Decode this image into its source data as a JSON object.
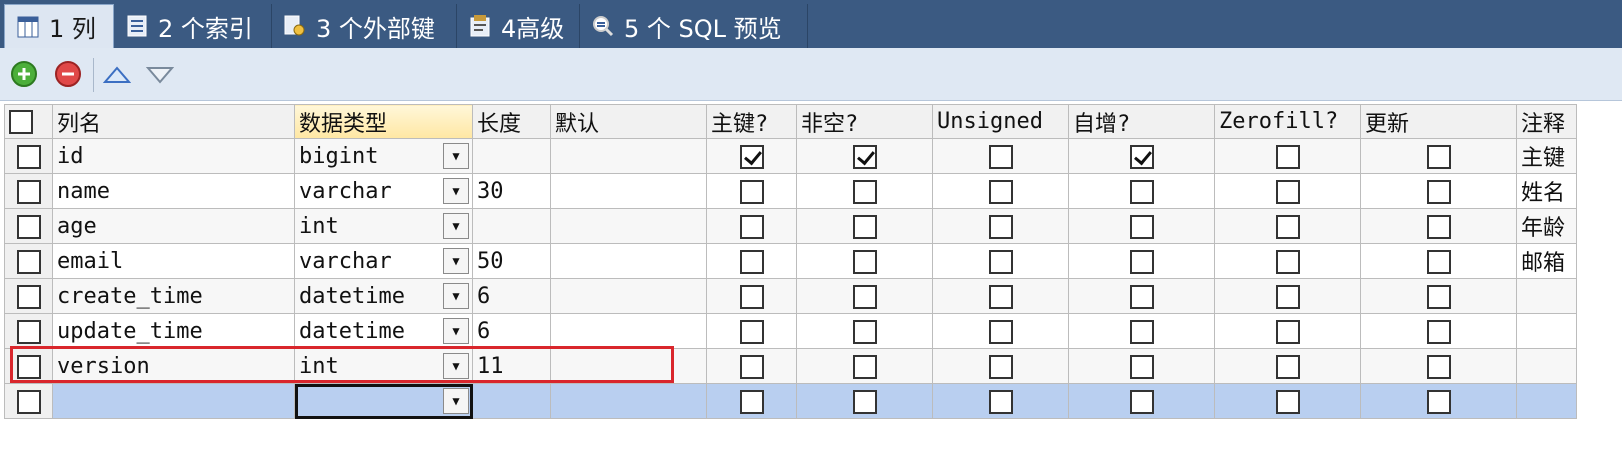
{
  "tabs": [
    {
      "label": "1 列",
      "icon": "columns-icon"
    },
    {
      "label": "2 个索引",
      "icon": "index-icon"
    },
    {
      "label": "3 个外部键",
      "icon": "foreign-key-icon"
    },
    {
      "label": "4高级",
      "icon": "advanced-icon"
    },
    {
      "label": "5 个 SQL 预览",
      "icon": "sql-preview-icon"
    }
  ],
  "toolbar": {
    "add": "add-column-icon",
    "remove": "remove-column-icon",
    "up": "move-up-icon",
    "down": "move-down-icon"
  },
  "columns": [
    "列名",
    "数据类型",
    "长度",
    "默认",
    "主键?",
    "非空?",
    "Unsigned",
    "自增?",
    "Zerofill?",
    "更新",
    "注释"
  ],
  "rows": [
    {
      "name": "id",
      "type": "bigint",
      "length": "",
      "default": "",
      "pk": true,
      "notnull": true,
      "unsigned": false,
      "autoinc": true,
      "zerofill": false,
      "update": false,
      "comment": "主键"
    },
    {
      "name": "name",
      "type": "varchar",
      "length": "30",
      "default": "",
      "pk": false,
      "notnull": false,
      "unsigned": false,
      "autoinc": false,
      "zerofill": false,
      "update": false,
      "comment": "姓名"
    },
    {
      "name": "age",
      "type": "int",
      "length": "",
      "default": "",
      "pk": false,
      "notnull": false,
      "unsigned": false,
      "autoinc": false,
      "zerofill": false,
      "update": false,
      "comment": "年龄"
    },
    {
      "name": "email",
      "type": "varchar",
      "length": "50",
      "default": "",
      "pk": false,
      "notnull": false,
      "unsigned": false,
      "autoinc": false,
      "zerofill": false,
      "update": false,
      "comment": "邮箱"
    },
    {
      "name": "create_time",
      "type": "datetime",
      "length": "6",
      "default": "",
      "pk": false,
      "notnull": false,
      "unsigned": false,
      "autoinc": false,
      "zerofill": false,
      "update": false,
      "comment": ""
    },
    {
      "name": "update_time",
      "type": "datetime",
      "length": "6",
      "default": "",
      "pk": false,
      "notnull": false,
      "unsigned": false,
      "autoinc": false,
      "zerofill": false,
      "update": false,
      "comment": ""
    },
    {
      "name": "version",
      "type": "int",
      "length": "11",
      "default": "",
      "pk": false,
      "notnull": false,
      "unsigned": false,
      "autoinc": false,
      "zerofill": false,
      "update": false,
      "comment": ""
    },
    {
      "name": "",
      "type": "",
      "length": "",
      "default": "",
      "pk": false,
      "notnull": false,
      "unsigned": false,
      "autoinc": false,
      "zerofill": false,
      "update": false,
      "comment": ""
    }
  ],
  "colors": {
    "tabbar": "#3b5a82",
    "highlight": "#d9262c",
    "newrow": "#b9cff0"
  }
}
